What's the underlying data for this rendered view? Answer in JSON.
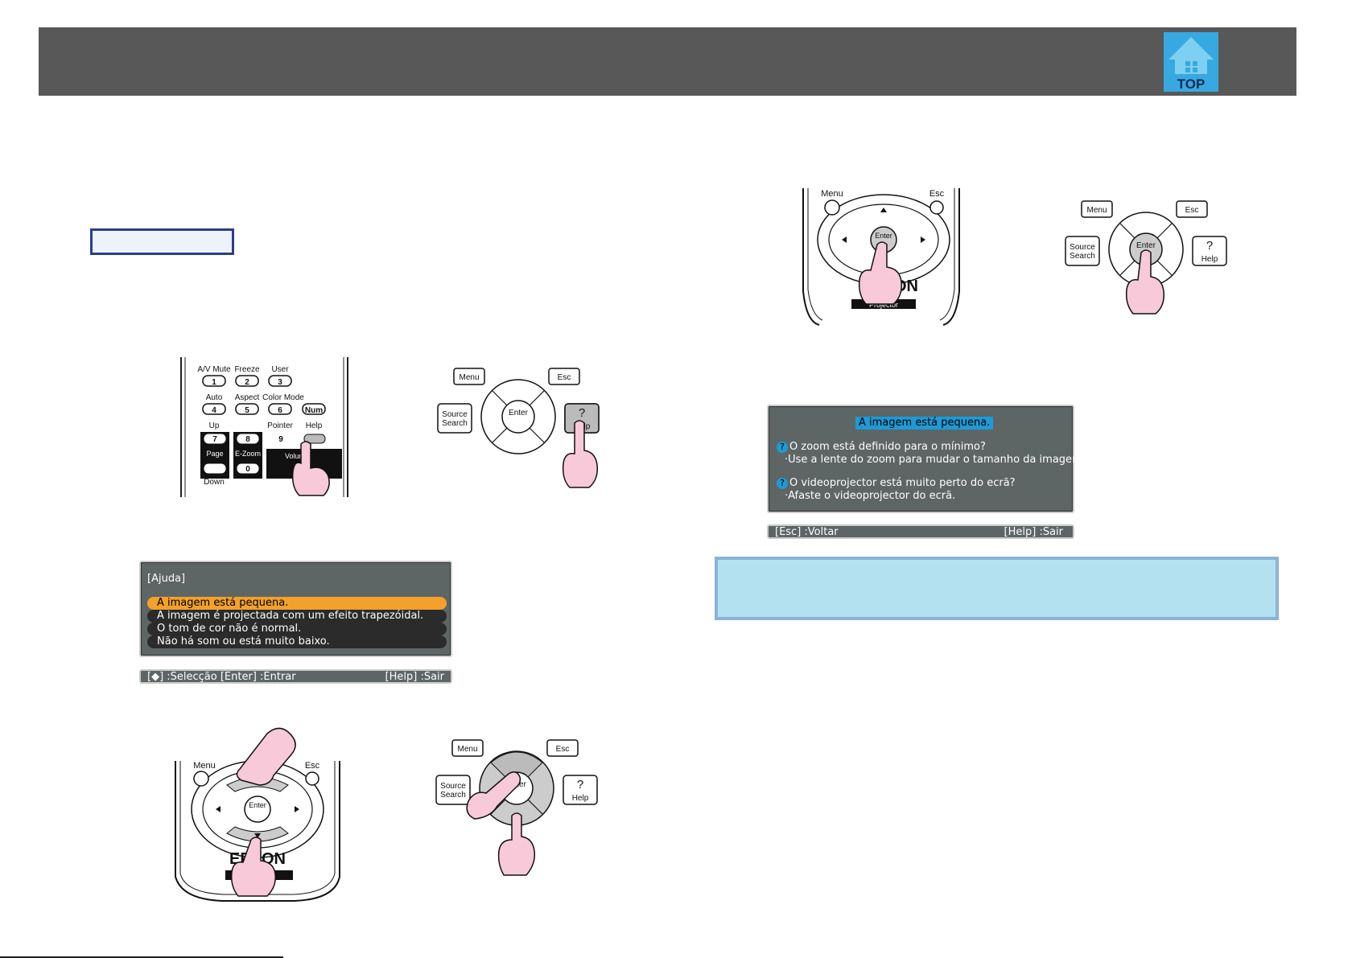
{
  "header": {
    "top_icon_label": "TOP",
    "top_icon_name": "home-icon"
  },
  "colors": {
    "header_bar": "#585858",
    "top_icon": "#37a9e0",
    "osd_background": "#5e6565",
    "osd_selected": "#f3a12a",
    "osd_highlight": "#1e9ad6",
    "hand": "#f8c9d8",
    "note_box": "#b4e1ef"
  },
  "remote1": {
    "labels": {
      "avmute": "A/V Mute",
      "freeze": "Freeze",
      "user": "User",
      "k1": "1",
      "k2": "2",
      "k3": "3",
      "auto": "Auto",
      "aspect": "Aspect",
      "colormode": "Color Mode",
      "k4": "4",
      "k5": "5",
      "k6": "6",
      "num": "Num",
      "up": "Up",
      "pointer": "Pointer",
      "help": "Help",
      "k7": "7",
      "k8": "8",
      "k9": "9",
      "k0": "0",
      "page": "Page",
      "ezoom": "E-Zoom",
      "volume": "Volume",
      "down": "Down"
    }
  },
  "panel_labels": {
    "menu": "Menu",
    "esc": "Esc",
    "source": "Source",
    "search": "Search",
    "enter": "Enter",
    "help": "Help",
    "question": "?"
  },
  "remote_nav": {
    "menu": "Menu",
    "esc": "Esc",
    "enter": "Enter",
    "brand": "EPSON",
    "projector": "Projector"
  },
  "help_menu": {
    "title": "[Ajuda]",
    "items": [
      "A imagem está pequena.",
      "A imagem é projectada com um efeito trapezóidal.",
      "O tom de cor não é normal.",
      "Não há som ou está muito baixo."
    ],
    "footer_left": "[◆] :Selecção  [Enter] :Entrar",
    "footer_right": "[Help] :Sair"
  },
  "help_detail": {
    "title": "A imagem está pequena.",
    "q1": "O zoom está definido para o mínimo?",
    "a1": "·Use a lente do zoom para mudar o tamanho da imagem.",
    "q2": "O videoprojector está muito perto do ecrã?",
    "a2": "·Afaste o videoprojector do ecrã.",
    "footer_left": "[Esc] :Voltar",
    "footer_right": "[Help] :Sair"
  }
}
